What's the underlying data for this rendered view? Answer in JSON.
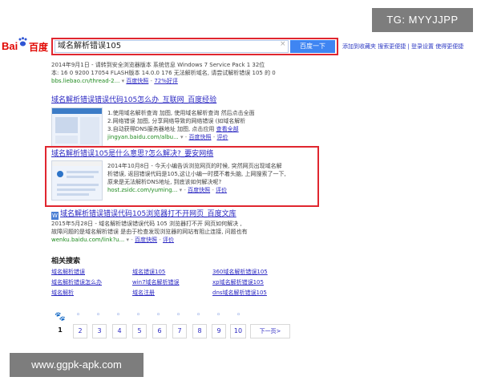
{
  "overlay": {
    "tg": "TG: MYYJJPP",
    "watermark": "www.ggpk-apk.com"
  },
  "logo": {
    "part1": "Bai",
    "part2": "百度"
  },
  "search": {
    "value": "域名解析错误105",
    "button": "百度一下",
    "clear_icon": "×"
  },
  "header_links": "添加到收藏夹  搜索更便捷 | 登录设置 使得更便捷",
  "results": [
    {
      "lines": [
        "2014年9月1日 - 请转到安全浏览器版本 系统信息 Windows 7 Service Pack 1 32位",
        "本: 16 0 9200 17054 FLASH版本 14.0.0 176 无法解析域名, 请尝试解析错误 105 的 0"
      ],
      "url": "bbs.liebao.cn/thread-2...",
      "cache": "百度快照",
      "rating": "72%好评"
    },
    {
      "title": "域名解析错误错误代码105怎么办_互联网_百度经验",
      "lines": [
        "1.使用域名解析查询 加图, 使用域名解析查询 然后点击全面",
        "2.网络错误 加图, 分享网络导致的网络错误 (如域名解析",
        "3.自动获得DNS服务器地址 加图, 点击应用"
      ],
      "url": "jingyan.baidu.com/albu...",
      "more": "查看全部",
      "cache": "百度快照",
      "rating": "评价"
    },
    {
      "title": "域名解析错误105是什么意思?怎么解决?_要安网络",
      "lines": [
        "2014年10月8日 - 今天小编告诉浏览网页的时候, 突然网页出现域名解",
        "析错误, 返回错误代码是105,这让小编一时摸不着头脑, 上网搜索了一下,",
        "原来是无法解析DNS地址, 到底该如何解决呢?"
      ],
      "url": "host.zsidc.com/yuming...",
      "cache": "百度快照",
      "rating": "评价"
    },
    {
      "title": "域名解析错误错误代码105浏览器打不开网页_百度文库",
      "lines": [
        "2015年5月28日 - 域名解析错误错误代码 105 浏览器打不开 网页如何解决 ,",
        "故障问题的是域名解析错误 是由于检查发现浏览器的网站有阻止连接, 问题也有"
      ],
      "url": "wenku.baidu.com/link?u...",
      "cache": "百度快照",
      "rating": "评价"
    }
  ],
  "related": {
    "title": "相关搜索",
    "items": [
      [
        "域名解析错误",
        "域名错误105",
        "360域名解析错误105"
      ],
      [
        "域名解析错误怎么办",
        "win7域名解析错误",
        "xp域名解析错误105"
      ],
      [
        "域名解析",
        "域名注册",
        "dns域名解析错误105"
      ]
    ]
  },
  "pagination": {
    "current": "1",
    "pages": [
      "2",
      "3",
      "4",
      "5",
      "6",
      "7",
      "8",
      "9",
      "10"
    ],
    "next": "下一页>"
  }
}
